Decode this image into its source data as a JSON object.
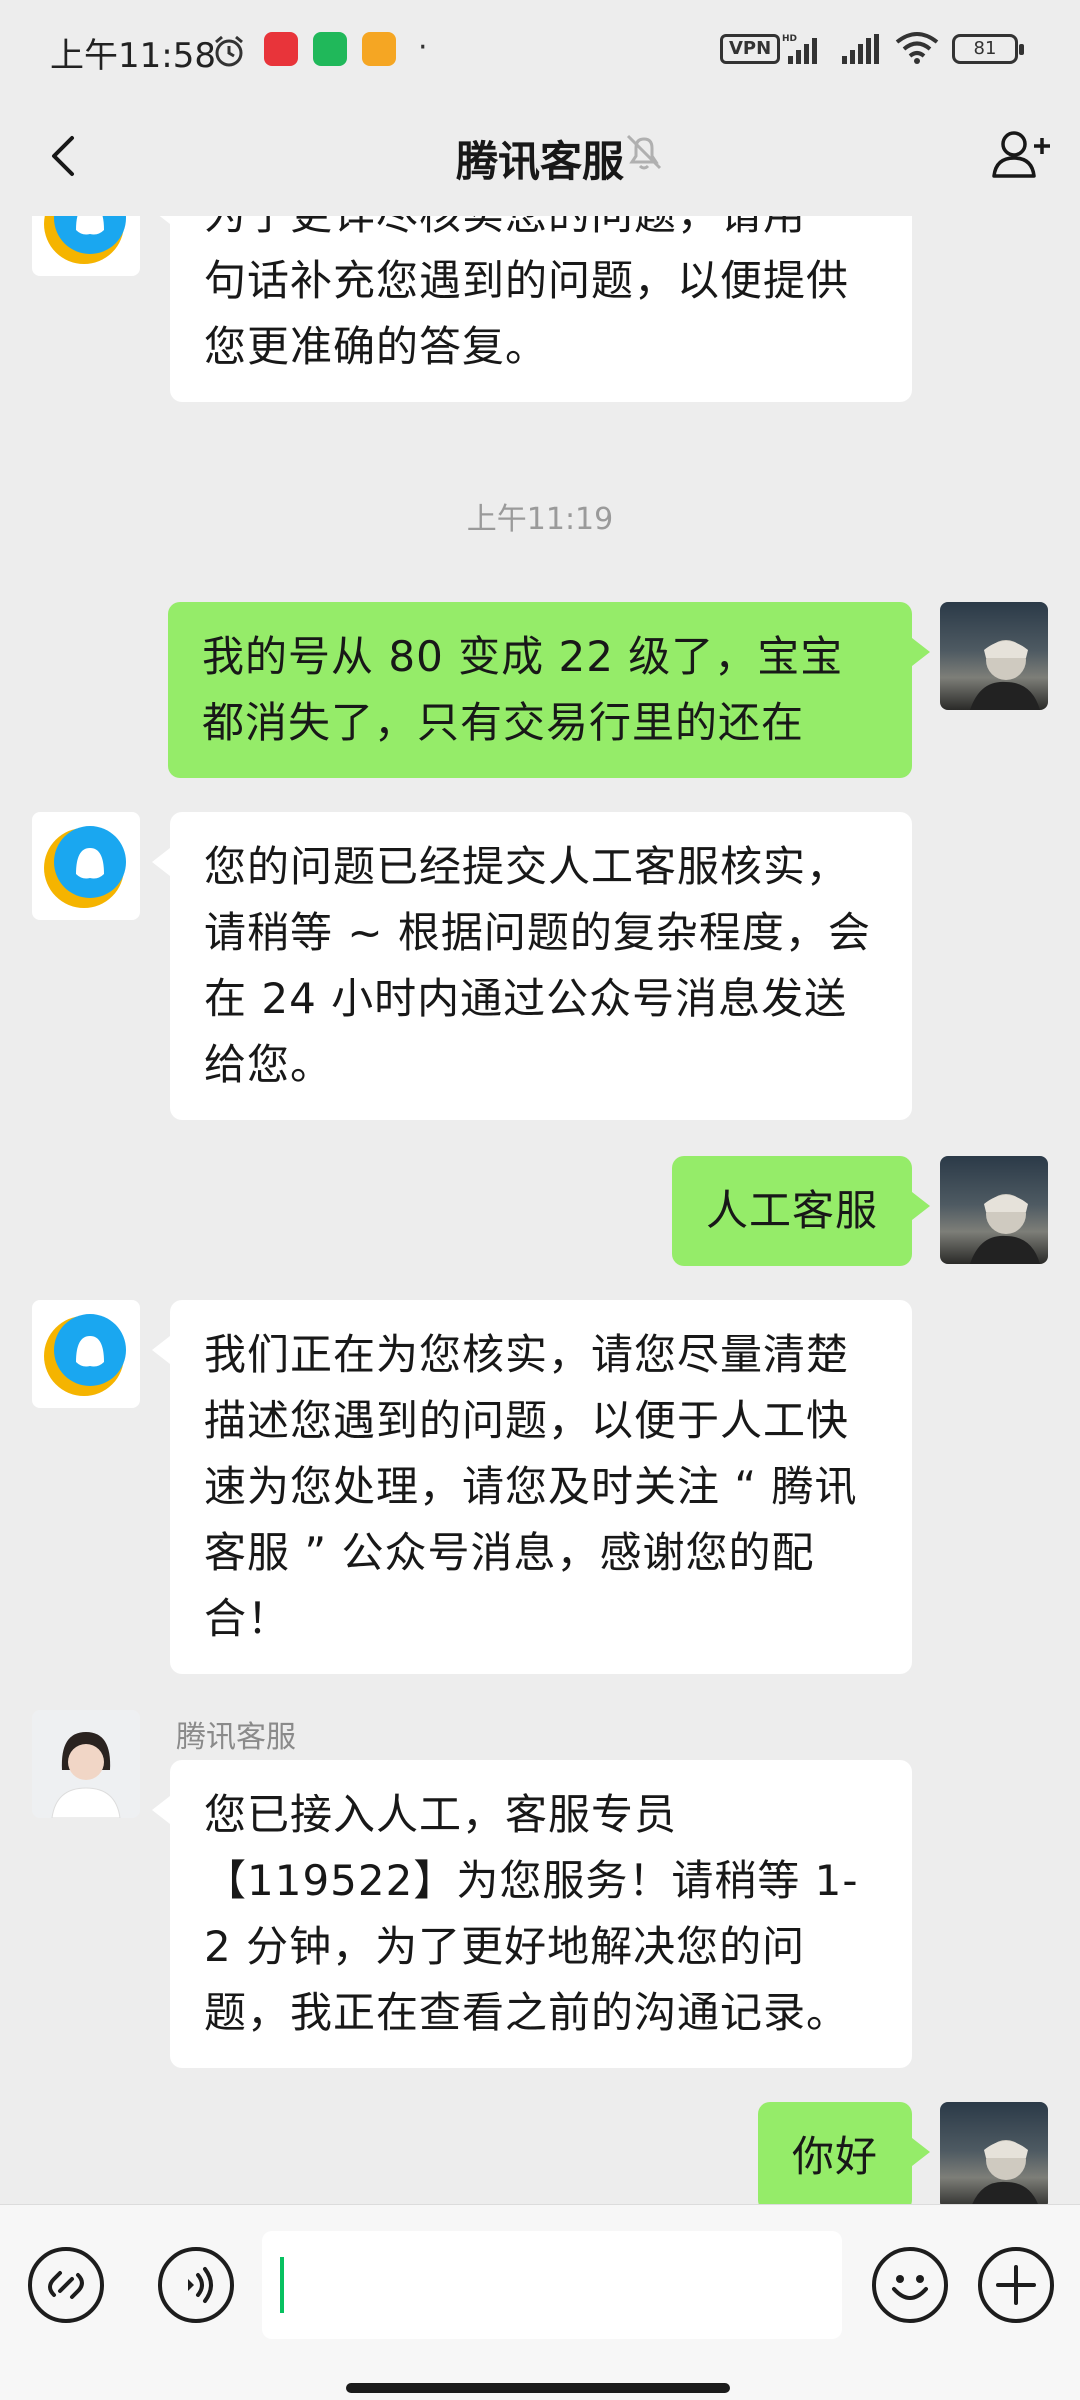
{
  "status_bar": {
    "time": "上午11:58",
    "dot": "·",
    "vpn": "VPN",
    "battery": "81"
  },
  "header": {
    "title": "腾讯客服"
  },
  "messages": [
    {
      "side": "left",
      "text": "为了更详尽核实您的问题，请用一句话补充您遇到的问题，以便提供您更准确的答复。"
    },
    {
      "type": "timestamp",
      "text": "上午11:19"
    },
    {
      "side": "right",
      "text": "我的号从 80 变成 22 级了，宝宝都消失了，只有交易行里的还在"
    },
    {
      "side": "left",
      "text": "您的问题已经提交人工客服核实，请稍等 ~ 根据问题的复杂程度，会在 24 小时内通过公众号消息发送给您。"
    },
    {
      "side": "right",
      "text": "人工客服"
    },
    {
      "side": "left",
      "text": "我们正在为您核实，请您尽量清楚描述您遇到的问题，以便于人工快速为您处理，请您及时关注 “ 腾讯客服 ” 公众号消息，感谢您的配合！"
    },
    {
      "side": "left",
      "sender": "腾讯客服",
      "text": "您已接入人工，客服专员【119522】为您服务！请稍等 1-2 分钟，为了更好地解决您的问题，我正在查看之前的沟通记录。"
    },
    {
      "side": "right",
      "text": "你好"
    }
  ],
  "input": {
    "value": ""
  },
  "colors": {
    "background": "#ededed",
    "outgoing_bubble": "#95ec69",
    "incoming_bubble": "#ffffff",
    "caret": "#07c160"
  },
  "icons": [
    "back-arrow-icon",
    "mute-bell-icon",
    "add-user-icon",
    "link-icon",
    "voice-icon",
    "emoji-icon",
    "plus-icon"
  ]
}
